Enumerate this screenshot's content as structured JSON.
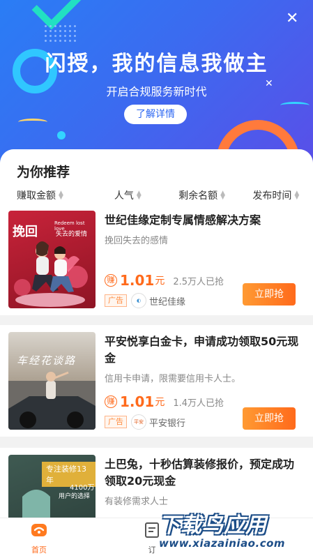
{
  "banner": {
    "title": "闪授，我的信息我做主",
    "subtitle": "开启合规服务新时代",
    "button": "了解详情"
  },
  "section": {
    "title": "为你推荐",
    "sorts": [
      "赚取金额",
      "人气",
      "剩余名额",
      "发布时间"
    ]
  },
  "cards": [
    {
      "thumb_text": "挽回",
      "thumb_text_en": "Redeem lost love",
      "thumb_text_sub": "失去的爱情",
      "title": "世纪佳缘定制专属情感解决方案",
      "desc": "挽回失去的感情",
      "earn_badge": "赚",
      "amount": "1.01",
      "unit": "元",
      "count": "2.5万人已抢",
      "ad": "广告",
      "brand": "世纪佳缘",
      "button": "立即抢"
    },
    {
      "thumb_text": "车经花谈路",
      "title": "平安悦享白金卡，申请成功领取50元现金",
      "desc": "信用卡申请，限需要信用卡人士。",
      "earn_badge": "赚",
      "amount": "1.01",
      "unit": "元",
      "count": "1.4万人已抢",
      "ad": "广告",
      "brand_logo": "平安",
      "brand": "平安银行",
      "button": "立即抢"
    },
    {
      "thumb_text": "专注装修13年",
      "thumb_num": "4100万",
      "thumb_num_sub": "用户的选择",
      "title": "土巴兔，十秒估算装修报价，预定成功领取20元现金",
      "desc": "有装修需求人士"
    }
  ],
  "tabbar": {
    "home": "首页",
    "order": "订"
  },
  "watermark": {
    "main": "下载鸟应用",
    "url": "www.xiazainiao.com"
  },
  "colors": {
    "accent": "#ff6a1b",
    "banner_blue": "#2a7df5"
  }
}
